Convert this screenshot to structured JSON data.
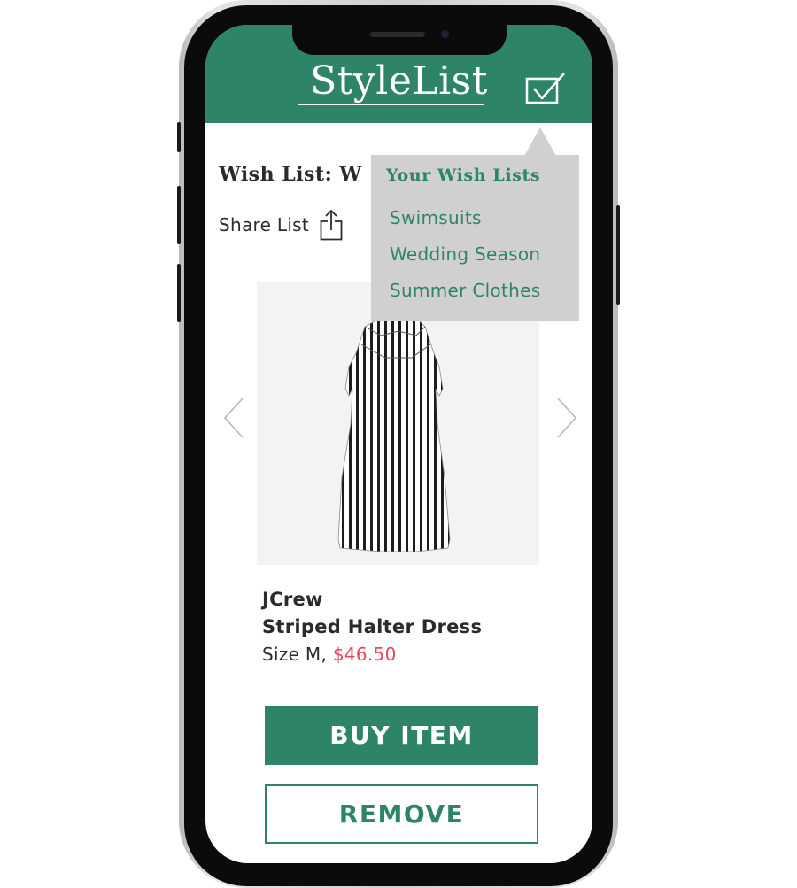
{
  "app": {
    "logo": "StyleList",
    "brand_color": "#2e8468",
    "wishlist_icon": "checkbox-icon"
  },
  "wishlist": {
    "title": "Wish List: W",
    "share_label": "Share List",
    "share_icon": "share-icon"
  },
  "dropdown": {
    "heading": "Your Wish Lists",
    "items": [
      "Swimsuits",
      "Wedding Season",
      "Summer Clothes"
    ]
  },
  "product": {
    "image_icon": "striped-dress-image",
    "brand": "JCrew",
    "name": "Striped Halter Dress",
    "size": "Size M,",
    "price": "$46.50",
    "price_color": "#e64560",
    "prev_icon": "chevron-left-icon",
    "next_icon": "chevron-right-icon"
  },
  "actions": {
    "buy_label": "BUY ITEM",
    "remove_label": "REMOVE"
  }
}
